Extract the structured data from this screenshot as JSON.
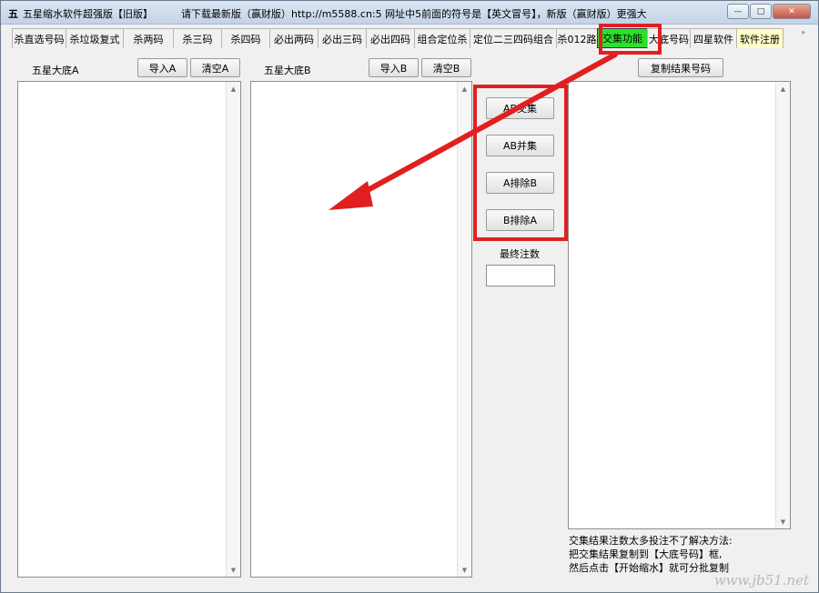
{
  "titlebar": {
    "icon_char": "五",
    "title": "五星缩水软件超强版【旧版】",
    "notice": "请下载最新版（赢财版）http://m5588.cn:5 网址中5前面的符号是【英文冒号】，新版（赢财版）更强大",
    "minimize_label": "—",
    "maximize_label": "□",
    "close_label": "✕"
  },
  "tabs": [
    {
      "label": "杀直选号码"
    },
    {
      "label": "杀垃圾复式"
    },
    {
      "label": "杀两码"
    },
    {
      "label": "杀三码"
    },
    {
      "label": "杀四码"
    },
    {
      "label": "必出两码"
    },
    {
      "label": "必出三码"
    },
    {
      "label": "必出四码"
    },
    {
      "label": "组合定位杀"
    },
    {
      "label": "定位二三四码组合"
    },
    {
      "label": "杀012路"
    },
    {
      "label": "交集功能"
    },
    {
      "label": "大底号码"
    },
    {
      "label": "四星软件"
    },
    {
      "label": "软件注册"
    }
  ],
  "active_tab": "交集功能",
  "panel_a": {
    "title": "五星大底A",
    "import_label": "导入A",
    "clear_label": "清空A"
  },
  "panel_b": {
    "title": "五星大底B",
    "import_label": "导入B",
    "clear_label": "清空B"
  },
  "operations": {
    "intersect_label": "AB交集",
    "union_label": "AB并集",
    "a_minus_b_label": "A排除B",
    "b_minus_a_label": "B排除A",
    "final_count_label": "最终注数",
    "final_count_value": ""
  },
  "result": {
    "copy_label": "复制结果号码",
    "note_lines": [
      "交集结果注数太多投注不了解决方法:",
      "把交集结果复制到【大底号码】框,",
      "然后点击【开始缩水】就可分批复制"
    ]
  },
  "watermark": "www.jb51.net",
  "colors": {
    "highlight": "#e02020",
    "active_tab": "#2ee02e",
    "register_tab": "#ffffc8"
  }
}
